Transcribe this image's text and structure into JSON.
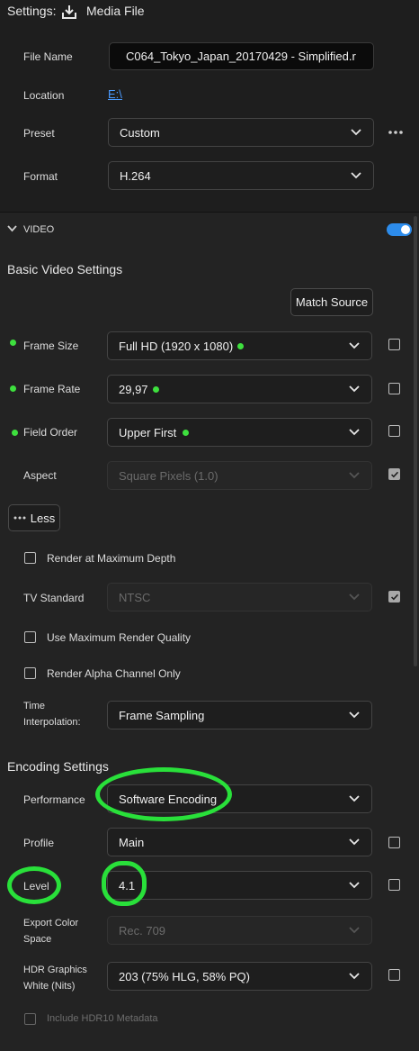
{
  "header": {
    "title": "Settings:",
    "media_label": "Media File"
  },
  "file": {
    "file_name_label": "File Name",
    "file_name_value": "C064_Tokyo_Japan_20170429 - Simplified.r",
    "location_label": "Location",
    "location_value": "E:\\",
    "preset_label": "Preset",
    "preset_value": "Custom",
    "format_label": "Format",
    "format_value": "H.264"
  },
  "video": {
    "section_label": "VIDEO",
    "basic_heading": "Basic Video Settings",
    "match_source": "Match Source",
    "frame_size_label": "Frame Size",
    "frame_size_value": "Full HD (1920 x 1080)",
    "frame_rate_label": "Frame Rate",
    "frame_rate_value": "29,97",
    "field_order_label": "Field Order",
    "field_order_value": "Upper First",
    "aspect_label": "Aspect",
    "aspect_value": "Square Pixels (1.0)",
    "less_button": "Less",
    "render_max_depth": "Render at Maximum Depth",
    "tv_standard_label": "TV Standard",
    "tv_standard_value": "NTSC",
    "max_render_quality": "Use Maximum Render Quality",
    "render_alpha": "Render Alpha Channel Only",
    "time_interp_label_1": "Time",
    "time_interp_label_2": "Interpolation:",
    "time_interp_value": "Frame Sampling"
  },
  "encoding": {
    "heading": "Encoding Settings",
    "performance_label": "Performance",
    "performance_value": "Software Encoding",
    "profile_label": "Profile",
    "profile_value": "Main",
    "level_label": "Level",
    "level_value": "4.1",
    "export_color_label_1": "Export Color",
    "export_color_label_2": "Space",
    "export_color_value": "Rec. 709",
    "hdr_label_1": "HDR Graphics",
    "hdr_label_2": "White (Nits)",
    "hdr_value": "203 (75% HLG, 58% PQ)",
    "hdr10_metadata": "Include HDR10 Metadata"
  },
  "colors": {
    "accent": "#2d8ceb",
    "annotation_green": "#29e03a",
    "dot_green": "#3ee03e"
  }
}
